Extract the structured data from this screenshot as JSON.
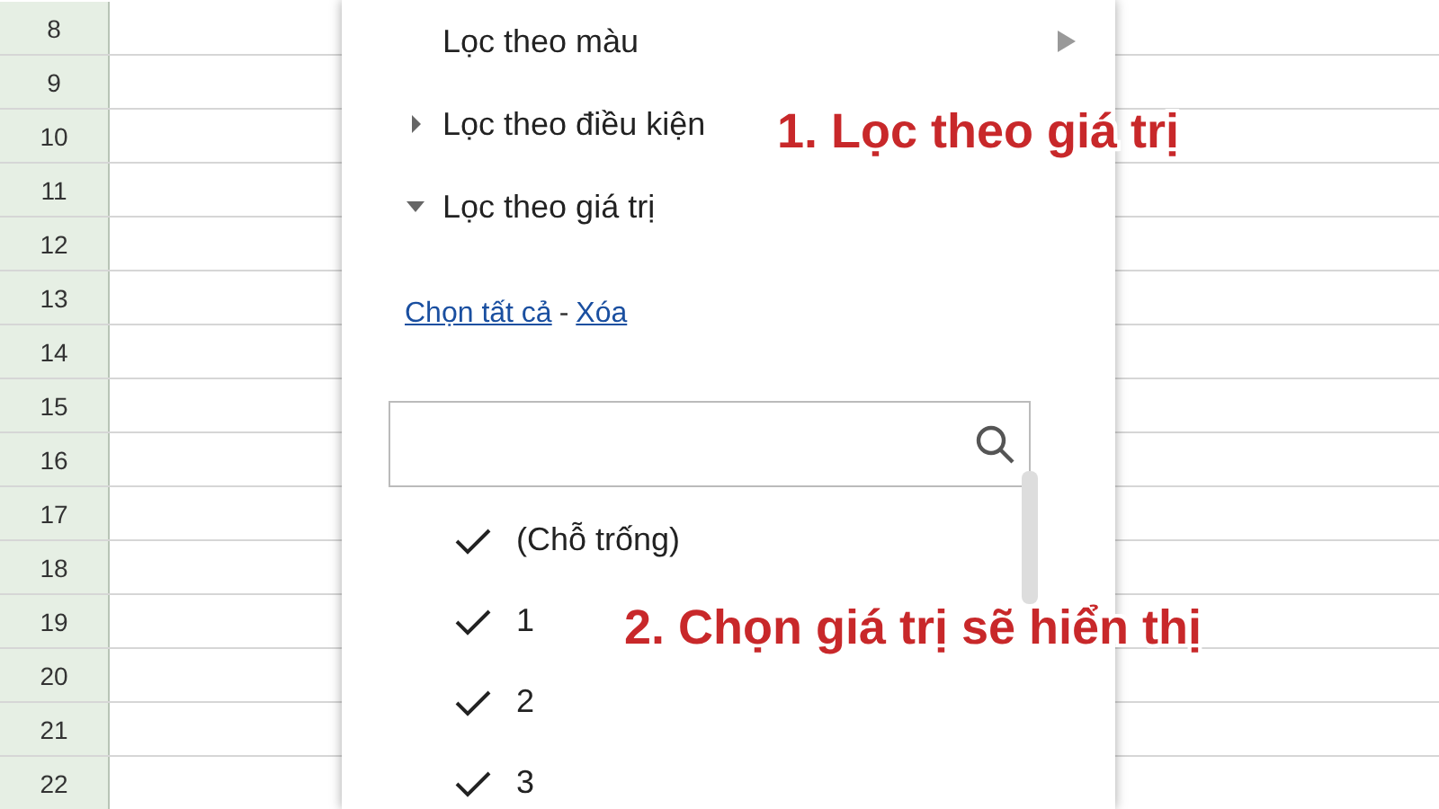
{
  "row_headers": [
    "8",
    "9",
    "10",
    "11",
    "12",
    "13",
    "14",
    "15",
    "16",
    "17",
    "18",
    "19",
    "20",
    "21",
    "22"
  ],
  "filter_menu": {
    "items": [
      {
        "label": "Lọc theo màu",
        "kind": "submenu"
      },
      {
        "label": "Lọc theo điều kiện",
        "kind": "section",
        "expanded": false
      },
      {
        "label": "Lọc theo giá trị",
        "kind": "section",
        "expanded": true
      }
    ],
    "select_all_link": "Chọn tất cả",
    "separator": "-",
    "clear_link": "Xóa",
    "values": [
      {
        "label": "(Chỗ trống)",
        "checked": true
      },
      {
        "label": "1",
        "checked": true
      },
      {
        "label": "2",
        "checked": true
      },
      {
        "label": "3",
        "checked": true
      }
    ]
  },
  "annotations": [
    {
      "text": "1. Lọc theo giá trị"
    },
    {
      "text": "2. Chọn giá trị sẽ hiển thị"
    }
  ]
}
